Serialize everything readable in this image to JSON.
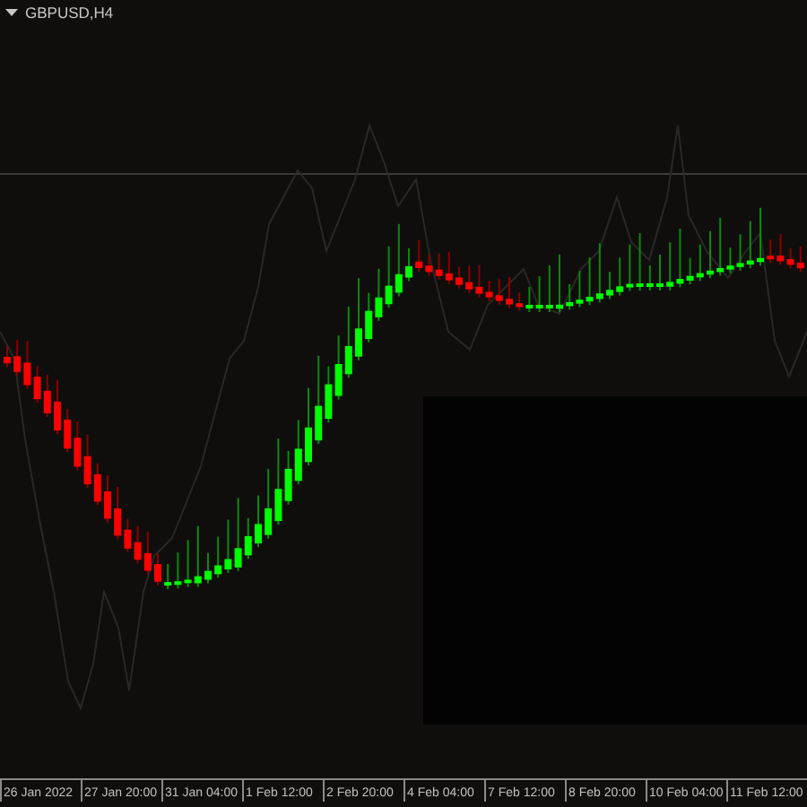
{
  "chart_title": "GBPUSD,H4",
  "x_axis_labels": [
    "26 Jan 2022",
    "27 Jan 20:00",
    "31 Jan 04:00",
    "1 Feb 12:00",
    "2 Feb 20:00",
    "4 Feb 04:00",
    "7 Feb 12:00",
    "8 Feb 20:00",
    "10 Feb 04:00",
    "11 Feb 12:00"
  ]
}
